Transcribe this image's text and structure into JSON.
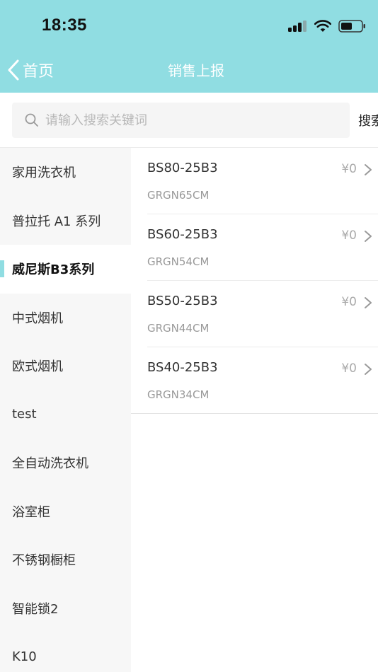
{
  "status_bar": {
    "time": "18:35"
  },
  "nav": {
    "back_label": "首页",
    "title": "销售上报"
  },
  "search": {
    "placeholder": "请输入搜索关键词",
    "button_label": "搜索"
  },
  "categories": [
    {
      "label": "家用洗衣机",
      "active": false
    },
    {
      "label": "普拉托 A1 系列",
      "active": false
    },
    {
      "label": "威尼斯B3系列",
      "active": true
    },
    {
      "label": "中式烟机",
      "active": false
    },
    {
      "label": "欧式烟机",
      "active": false
    },
    {
      "label": "test",
      "active": false
    },
    {
      "label": "全自动洗衣机",
      "active": false
    },
    {
      "label": "浴室柜",
      "active": false
    },
    {
      "label": "不锈钢橱柜",
      "active": false
    },
    {
      "label": "智能锁2",
      "active": false
    },
    {
      "label": "K10",
      "active": false
    }
  ],
  "products": [
    {
      "name": "BS80-25B3",
      "code": "GRGN65CM",
      "price": "¥0"
    },
    {
      "name": "BS60-25B3",
      "code": "GRGN54CM",
      "price": "¥0"
    },
    {
      "name": "BS50-25B3",
      "code": "GRGN44CM",
      "price": "¥0"
    },
    {
      "name": "BS40-25B3",
      "code": "GRGN34CM",
      "price": "¥0"
    }
  ],
  "colors": {
    "accent": "#90DDE2",
    "sidebar_bg": "#F7F7F7",
    "search_bg": "#F5F5F5"
  }
}
